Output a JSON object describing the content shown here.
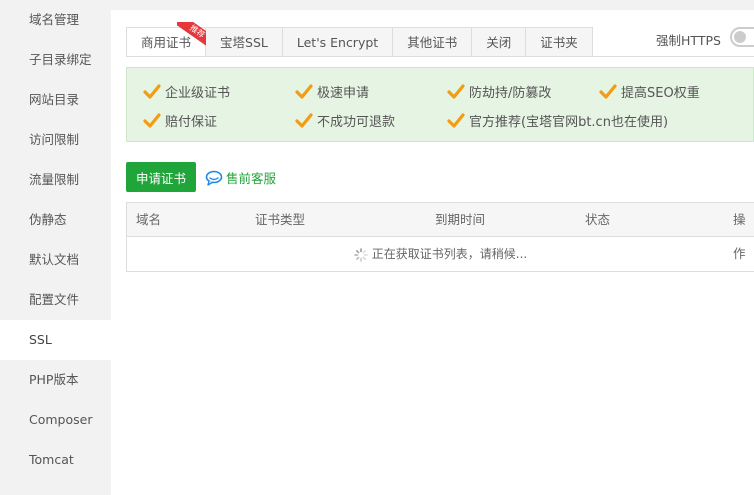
{
  "sidebar": {
    "items": [
      {
        "label": "域名管理"
      },
      {
        "label": "子目录绑定"
      },
      {
        "label": "网站目录"
      },
      {
        "label": "访问限制"
      },
      {
        "label": "流量限制"
      },
      {
        "label": "伪静态"
      },
      {
        "label": "默认文档"
      },
      {
        "label": "配置文件"
      },
      {
        "label": "SSL"
      },
      {
        "label": "PHP版本"
      },
      {
        "label": "Composer"
      },
      {
        "label": "Tomcat"
      }
    ],
    "active_index": 8
  },
  "tabs": {
    "items": [
      {
        "label": "商用证书"
      },
      {
        "label": "宝塔SSL"
      },
      {
        "label": "Let's Encrypt"
      },
      {
        "label": "其他证书"
      },
      {
        "label": "关闭"
      },
      {
        "label": "证书夹"
      }
    ],
    "active_index": 0,
    "ribbon": "推荐"
  },
  "force_https": {
    "label": "强制HTTPS",
    "enabled": false
  },
  "features": {
    "items": [
      {
        "label": "企业级证书"
      },
      {
        "label": "极速申请"
      },
      {
        "label": "防劫持/防篡改"
      },
      {
        "label": "提高SEO权重"
      },
      {
        "label": "赔付保证"
      },
      {
        "label": "不成功可退款"
      },
      {
        "label": "官方推荐(宝塔官网bt.cn也在使用)"
      }
    ]
  },
  "actions": {
    "apply_label": "申请证书",
    "presale_label": "售前客服"
  },
  "table": {
    "columns": [
      {
        "label": "域名"
      },
      {
        "label": "证书类型"
      },
      {
        "label": "到期时间"
      },
      {
        "label": "状态"
      },
      {
        "label": "操作"
      }
    ],
    "loading_text": "正在获取证书列表，请稍候..."
  },
  "colors": {
    "accent_green": "#20a53a",
    "check_orange": "#f39c12",
    "ribbon_red": "#e4393c",
    "feature_bg": "#e6f4e3"
  }
}
